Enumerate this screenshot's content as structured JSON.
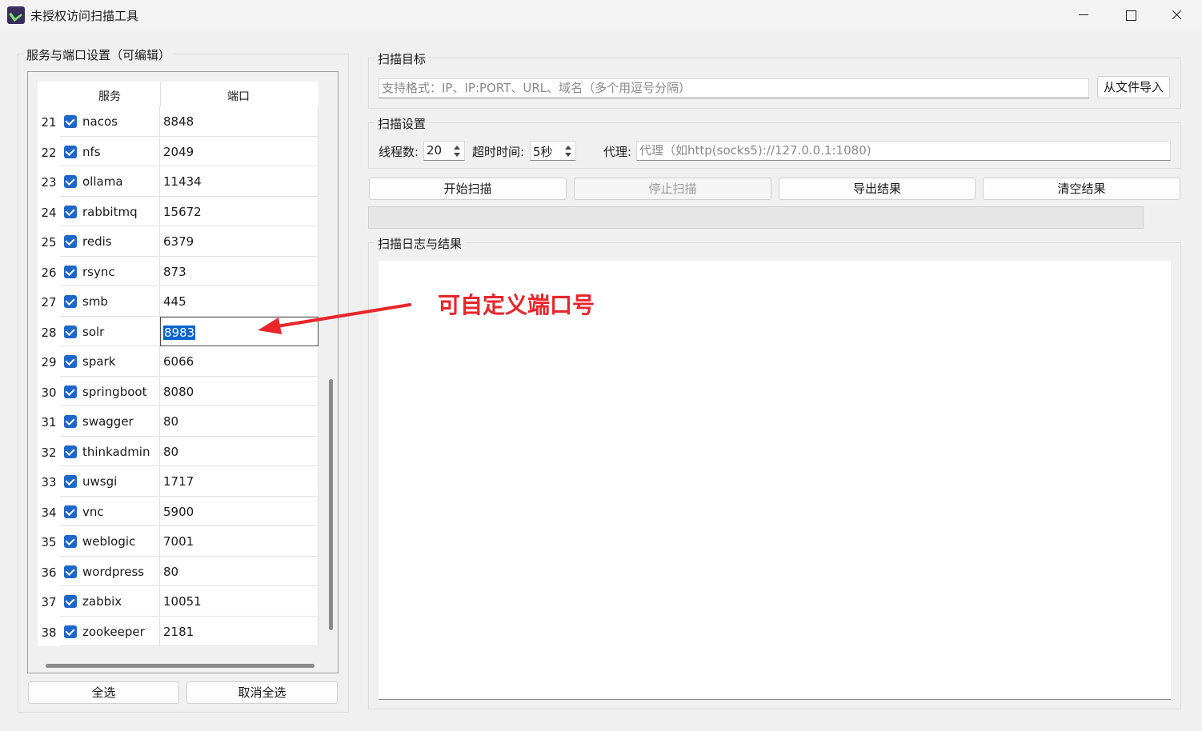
{
  "window": {
    "title": "未授权访问扫描工具"
  },
  "left_panel": {
    "group_title": "服务与端口设置（可编辑）",
    "columns": [
      "服务",
      "端口"
    ],
    "rows": [
      {
        "num": "21",
        "service": "nacos",
        "port": "8848",
        "checked": true
      },
      {
        "num": "22",
        "service": "nfs",
        "port": "2049",
        "checked": true
      },
      {
        "num": "23",
        "service": "ollama",
        "port": "11434",
        "checked": true
      },
      {
        "num": "24",
        "service": "rabbitmq",
        "port": "15672",
        "checked": true
      },
      {
        "num": "25",
        "service": "redis",
        "port": "6379",
        "checked": true
      },
      {
        "num": "26",
        "service": "rsync",
        "port": "873",
        "checked": true
      },
      {
        "num": "27",
        "service": "smb",
        "port": "445",
        "checked": true
      },
      {
        "num": "28",
        "service": "solr",
        "port": "8983",
        "checked": true,
        "editing": true
      },
      {
        "num": "29",
        "service": "spark",
        "port": "6066",
        "checked": true
      },
      {
        "num": "30",
        "service": "springboot",
        "port": "8080",
        "checked": true
      },
      {
        "num": "31",
        "service": "swagger",
        "port": "80",
        "checked": true
      },
      {
        "num": "32",
        "service": "thinkadmin",
        "port": "80",
        "checked": true
      },
      {
        "num": "33",
        "service": "uwsgi",
        "port": "1717",
        "checked": true
      },
      {
        "num": "34",
        "service": "vnc",
        "port": "5900",
        "checked": true
      },
      {
        "num": "35",
        "service": "weblogic",
        "port": "7001",
        "checked": true
      },
      {
        "num": "36",
        "service": "wordpress",
        "port": "80",
        "checked": true
      },
      {
        "num": "37",
        "service": "zabbix",
        "port": "10051",
        "checked": true
      },
      {
        "num": "38",
        "service": "zookeeper",
        "port": "2181",
        "checked": true
      }
    ],
    "select_all_label": "全选",
    "deselect_all_label": "取消全选"
  },
  "target": {
    "group_title": "扫描目标",
    "placeholder": "支持格式：IP、IP:PORT、URL、域名（多个用逗号分隔）",
    "import_label": "从文件导入"
  },
  "settings": {
    "group_title": "扫描设置",
    "threads_label": "线程数:",
    "threads_value": "20",
    "timeout_label": "超时时间:",
    "timeout_value": "5秒",
    "proxy_label": "代理:",
    "proxy_placeholder": "代理（如http(socks5)://127.0.0.1:1080)"
  },
  "actions": {
    "start": "开始扫描",
    "stop": "停止扫描",
    "export": "导出结果",
    "clear": "清空结果"
  },
  "progress": {
    "value_percent": 0
  },
  "log": {
    "group_title": "扫描日志与结果"
  },
  "annotation": {
    "text": "可自定义端口号",
    "color": "#e8262b"
  }
}
